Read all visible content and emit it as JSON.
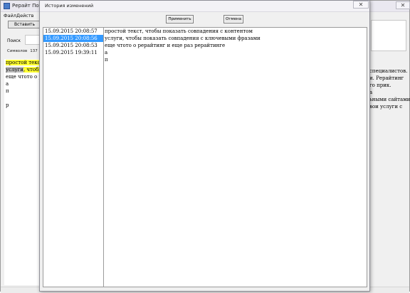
{
  "background_window": {
    "title": "Рерайт Послед",
    "close_glyph": "✕",
    "menu": [
      "Файл",
      "Действ"
    ],
    "paste_button": "Вставить",
    "search_label": "Поиск",
    "chars_label": "Символов",
    "chars_value": "137",
    "editor_lines": [
      {
        "segments": [
          {
            "text": "простой текст",
            "hl": "yellow"
          }
        ]
      },
      {
        "segments": [
          {
            "text": "услуги",
            "hl": "gray"
          },
          {
            "text": ", ",
            "hl": "yellow"
          },
          {
            "text": "чтобы",
            "hl": "yellow"
          }
        ]
      },
      {
        "segments": [
          {
            "text": "еще чтото о р",
            "hl": ""
          },
          {
            "text": "е",
            "hl": "gray"
          }
        ]
      },
      {
        "segments": [
          {
            "text": "а",
            "hl": ""
          }
        ]
      },
      {
        "segments": [
          {
            "text": "п",
            "hl": ""
          }
        ]
      },
      {
        "segments": [
          {
            "text": "",
            "hl": ""
          }
        ]
      },
      {
        "segments": [
          {
            "text": "р",
            "hl": ""
          }
        ]
      }
    ],
    "editor_right_lines": [
      "специалистов.",
      "и. Рерайтинг",
      "го прик.",
      "а",
      "ьными сайтами",
      "вои услуги с"
    ]
  },
  "dialog": {
    "title": "История изменений",
    "close_glyph": "✕",
    "apply_button": "Применить",
    "cancel_button": "Отмена",
    "history": [
      {
        "timestamp": "15.09.2015 20:08:57",
        "selected": false
      },
      {
        "timestamp": "15.09.2015 20:08:56",
        "selected": true
      },
      {
        "timestamp": "15.09.2015 20:08:53",
        "selected": false
      },
      {
        "timestamp": "15.09.2015 19:39:11",
        "selected": false
      }
    ],
    "text_lines": [
      "простой текст, чтобы показать совпадения с контентом",
      "услуги, чтобы показать совпадения с ключевыми фразами",
      "еще чтото о рерайтинг и еще раз рерайтинге",
      "а",
      "п"
    ]
  },
  "colors": {
    "selection": "#3399ff",
    "highlight_yellow": "#ffff33",
    "highlight_gray": "#bcbcbc"
  }
}
